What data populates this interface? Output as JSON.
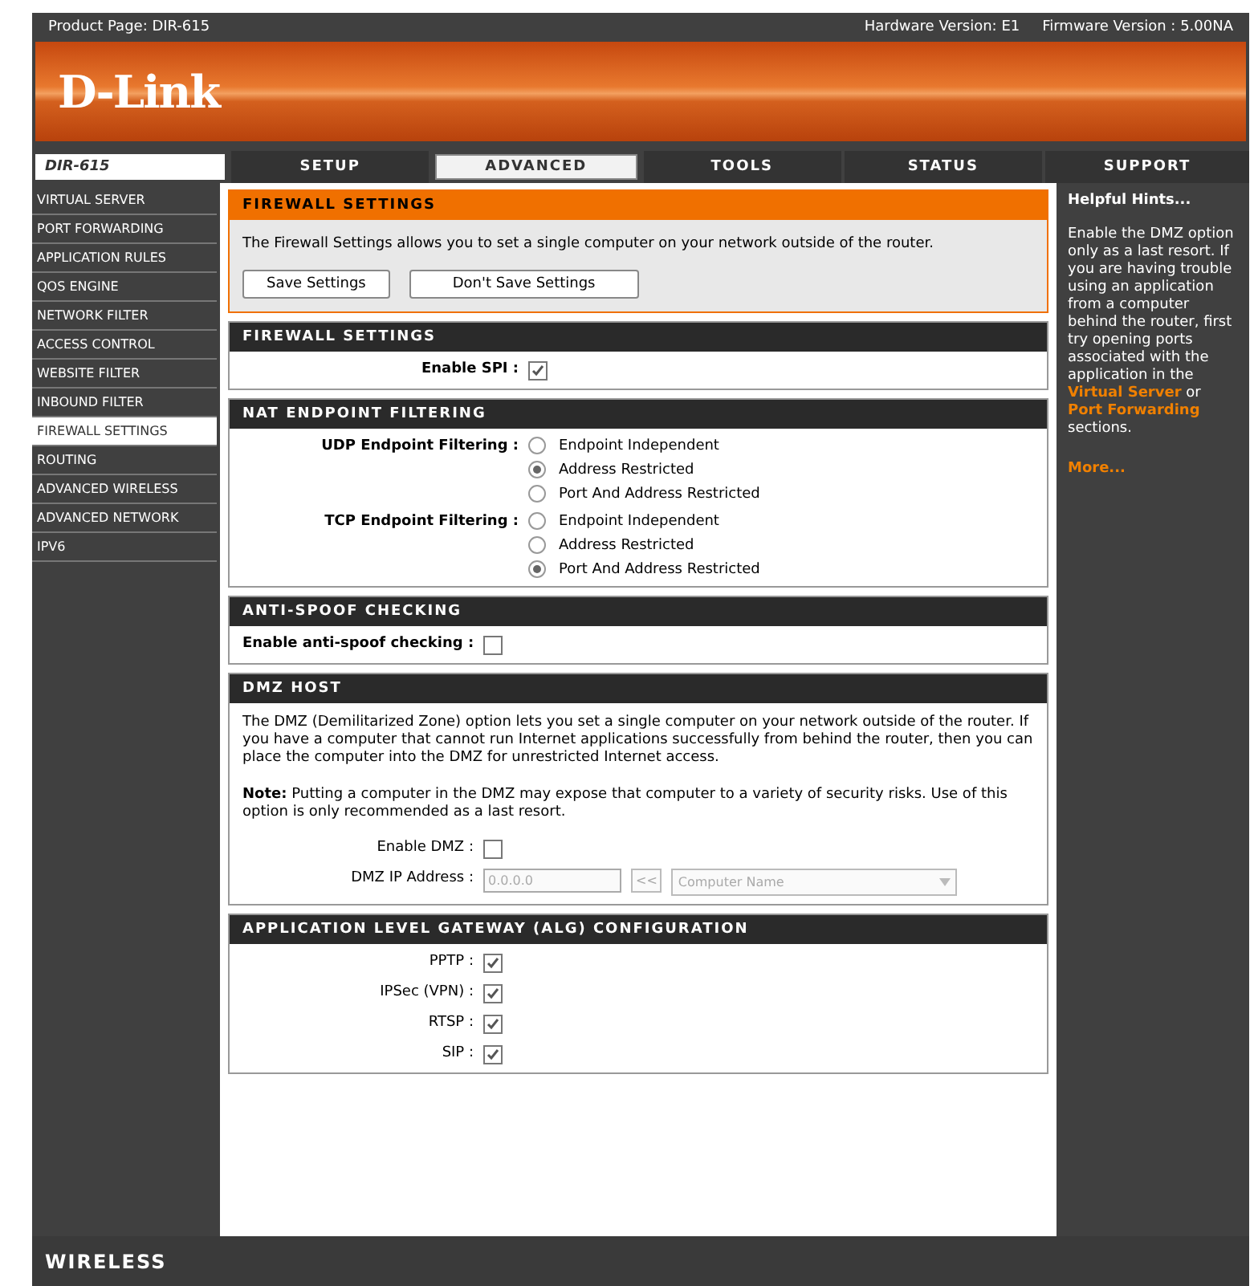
{
  "top_bar": {
    "product": "Product Page: DIR-615",
    "hardware": "Hardware Version: E1",
    "firmware": "Firmware Version : 5.00NA"
  },
  "logo": "D-Link",
  "model": "DIR-615",
  "tabs": [
    {
      "label": "SETUP",
      "selected": false
    },
    {
      "label": "ADVANCED",
      "selected": true
    },
    {
      "label": "TOOLS",
      "selected": false
    },
    {
      "label": "STATUS",
      "selected": false
    },
    {
      "label": "SUPPORT",
      "selected": false
    }
  ],
  "sidebar": {
    "items": [
      {
        "label": "VIRTUAL SERVER",
        "selected": false
      },
      {
        "label": "PORT FORWARDING",
        "selected": false
      },
      {
        "label": "APPLICATION RULES",
        "selected": false
      },
      {
        "label": "QOS ENGINE",
        "selected": false
      },
      {
        "label": "NETWORK FILTER",
        "selected": false
      },
      {
        "label": "ACCESS CONTROL",
        "selected": false
      },
      {
        "label": "WEBSITE FILTER",
        "selected": false
      },
      {
        "label": "INBOUND FILTER",
        "selected": false
      },
      {
        "label": "FIREWALL SETTINGS",
        "selected": true
      },
      {
        "label": "ROUTING",
        "selected": false
      },
      {
        "label": "ADVANCED WIRELESS",
        "selected": false
      },
      {
        "label": "ADVANCED NETWORK",
        "selected": false
      },
      {
        "label": "IPV6",
        "selected": false
      }
    ]
  },
  "intro": {
    "title": "FIREWALL SETTINGS",
    "text": "The Firewall Settings allows you to set a single computer on your network outside of the router.",
    "buttons": [
      "Save Settings",
      "Don't Save Settings"
    ]
  },
  "sections": [
    {
      "kind": "wide",
      "title": "FIREWALL SETTINGS",
      "fields": [
        {
          "kind": "checkbox",
          "label": "Enable SPI :",
          "checked": true
        }
      ]
    },
    {
      "kind": "wide",
      "title": "NAT ENDPOINT FILTERING",
      "fields": [
        {
          "kind": "radio",
          "label": "UDP Endpoint Filtering :",
          "options": [
            {
              "label": "Endpoint Independent",
              "selected": false
            },
            {
              "label": "Address Restricted",
              "selected": true
            },
            {
              "label": "Port And Address Restricted",
              "selected": false
            }
          ]
        },
        {
          "kind": "radio",
          "label": "TCP Endpoint Filtering :",
          "options": [
            {
              "label": "Endpoint Independent",
              "selected": false
            },
            {
              "label": "Address Restricted",
              "selected": false
            },
            {
              "label": "Port And Address Restricted",
              "selected": true
            }
          ]
        }
      ]
    },
    {
      "kind": "left",
      "title": "ANTI-SPOOF CHECKING",
      "fields": [
        {
          "kind": "checkbox",
          "label": "Enable anti-spoof checking :",
          "checked": false
        }
      ]
    },
    {
      "kind": "narrow",
      "title": "DMZ HOST",
      "paragraphs": [
        "The DMZ (Demilitarized Zone) option lets you set a single computer on your network outside of the router. If you have a computer that cannot run Internet applications successfully from behind the router, then you can place the computer into the DMZ for unrestricted Internet access.",
        "**Note:** Putting a computer in the DMZ may expose that computer to a variety of security risks. Use of this option is only recommended as a last resort."
      ],
      "fields": [
        {
          "kind": "checkbox",
          "label": "Enable DMZ :",
          "checked": false
        },
        {
          "kind": "ip",
          "label": "DMZ IP Address :",
          "value": "0.0.0.0",
          "button": "<<",
          "select": "Computer Name",
          "disabled": true
        }
      ]
    },
    {
      "kind": "narrow",
      "title": "APPLICATION LEVEL GATEWAY (ALG) CONFIGURATION",
      "fields": [
        {
          "kind": "checkbox",
          "label": "PPTP :",
          "checked": true
        },
        {
          "kind": "checkbox",
          "label": "IPSec (VPN) :",
          "checked": true
        },
        {
          "kind": "checkbox",
          "label": "RTSP :",
          "checked": true
        },
        {
          "kind": "checkbox",
          "label": "SIP :",
          "checked": true
        }
      ]
    }
  ],
  "hints": {
    "title": "Helpful Hints...",
    "parts": [
      {
        "kind": "text",
        "text": "Enable the DMZ option only as a last resort. If you are having trouble using an application from a computer behind the router, first try opening ports associated with the application in the"
      },
      {
        "kind": "link",
        "text": "Virtual Server"
      },
      {
        "kind": "text",
        "text": "or"
      },
      {
        "kind": "link",
        "text": "Port Forwarding"
      },
      {
        "kind": "text",
        "text": "sections."
      }
    ],
    "more": "More..."
  },
  "footer": "WIRELESS"
}
